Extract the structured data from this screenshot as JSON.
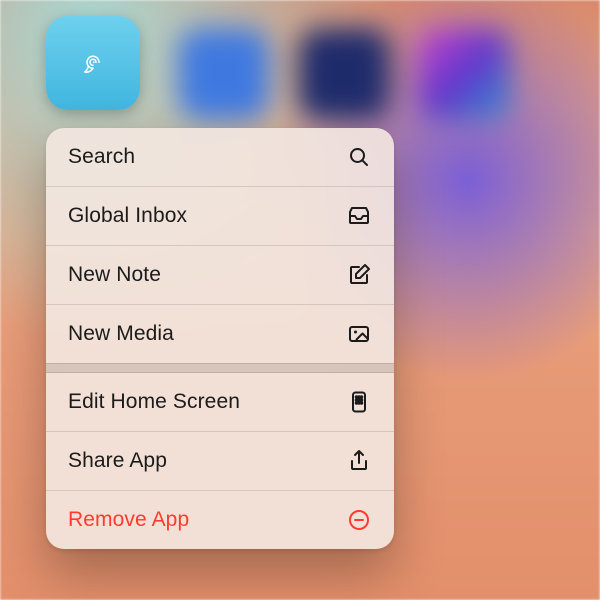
{
  "app": {
    "icon_name": "spiral-shell-icon"
  },
  "menu": {
    "section1": [
      {
        "label": "Search",
        "icon": "search-icon"
      },
      {
        "label": "Global Inbox",
        "icon": "inbox-icon"
      },
      {
        "label": "New Note",
        "icon": "compose-icon"
      },
      {
        "label": "New Media",
        "icon": "image-icon"
      }
    ],
    "section2": [
      {
        "label": "Edit Home Screen",
        "icon": "app-grid-icon"
      },
      {
        "label": "Share App",
        "icon": "share-icon"
      },
      {
        "label": "Remove App",
        "icon": "remove-circle-icon",
        "danger": true
      }
    ]
  },
  "colors": {
    "danger": "#ff3b30",
    "app_icon_bg_top": "#6ed0ee",
    "app_icon_bg_bottom": "#40b6df"
  }
}
